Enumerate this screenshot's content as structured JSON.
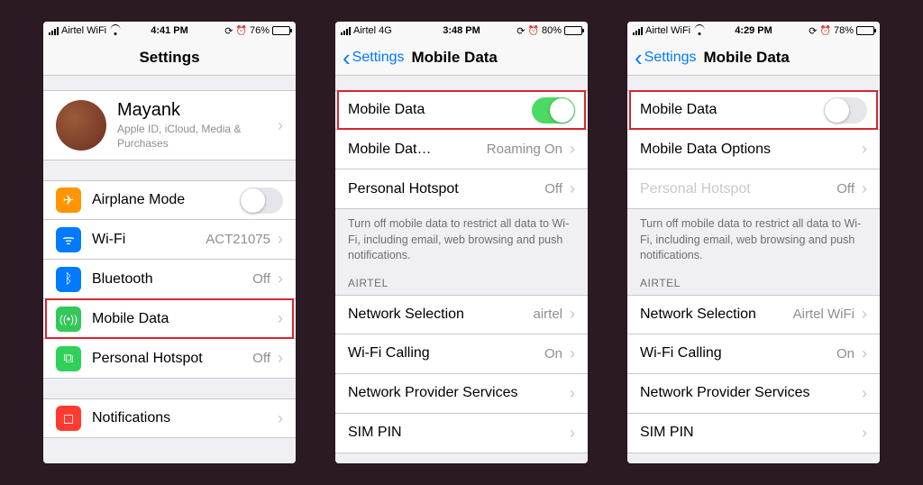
{
  "screen1": {
    "status": {
      "carrier": "Airtel WiFi",
      "time": "4:41 PM",
      "battery_pct": "76%",
      "battery_fill": 76
    },
    "nav": {
      "title": "Settings"
    },
    "profile": {
      "name": "Mayank",
      "sub": "Apple ID, iCloud, Media & Purchases"
    },
    "rows": {
      "airplane": "Airplane Mode",
      "wifi": "Wi-Fi",
      "wifi_val": "ACT21075",
      "bluetooth": "Bluetooth",
      "bluetooth_val": "Off",
      "mobile": "Mobile Data",
      "hotspot": "Personal Hotspot",
      "hotspot_val": "Off",
      "notifications": "Notifications"
    }
  },
  "screen2": {
    "status": {
      "carrier": "Airtel  4G",
      "time": "3:48 PM",
      "battery_pct": "80%",
      "battery_fill": 80
    },
    "nav": {
      "back": "Settings",
      "title": "Mobile Data"
    },
    "rows": {
      "mobile": "Mobile Data",
      "options": "Mobile Dat…",
      "options_val": "Roaming On",
      "hotspot": "Personal Hotspot",
      "hotspot_val": "Off"
    },
    "footer": "Turn off mobile data to restrict all data to Wi-Fi, including email, web browsing and push notifications.",
    "section": "AIRTEL",
    "carrier_rows": {
      "network": "Network Selection",
      "network_val": "airtel",
      "wificall": "Wi-Fi Calling",
      "wificall_val": "On",
      "provider": "Network Provider Services",
      "simpin": "SIM PIN"
    }
  },
  "screen3": {
    "status": {
      "carrier": "Airtel WiFi",
      "time": "4:29 PM",
      "battery_pct": "78%",
      "battery_fill": 78
    },
    "nav": {
      "back": "Settings",
      "title": "Mobile Data"
    },
    "rows": {
      "mobile": "Mobile Data",
      "options": "Mobile Data Options",
      "hotspot": "Personal Hotspot",
      "hotspot_val": "Off"
    },
    "footer": "Turn off mobile data to restrict all data to Wi-Fi, including email, web browsing and push notifications.",
    "section": "AIRTEL",
    "carrier_rows": {
      "network": "Network Selection",
      "network_val": "Airtel WiFi",
      "wificall": "Wi-Fi Calling",
      "wificall_val": "On",
      "provider": "Network Provider Services",
      "simpin": "SIM PIN"
    }
  }
}
